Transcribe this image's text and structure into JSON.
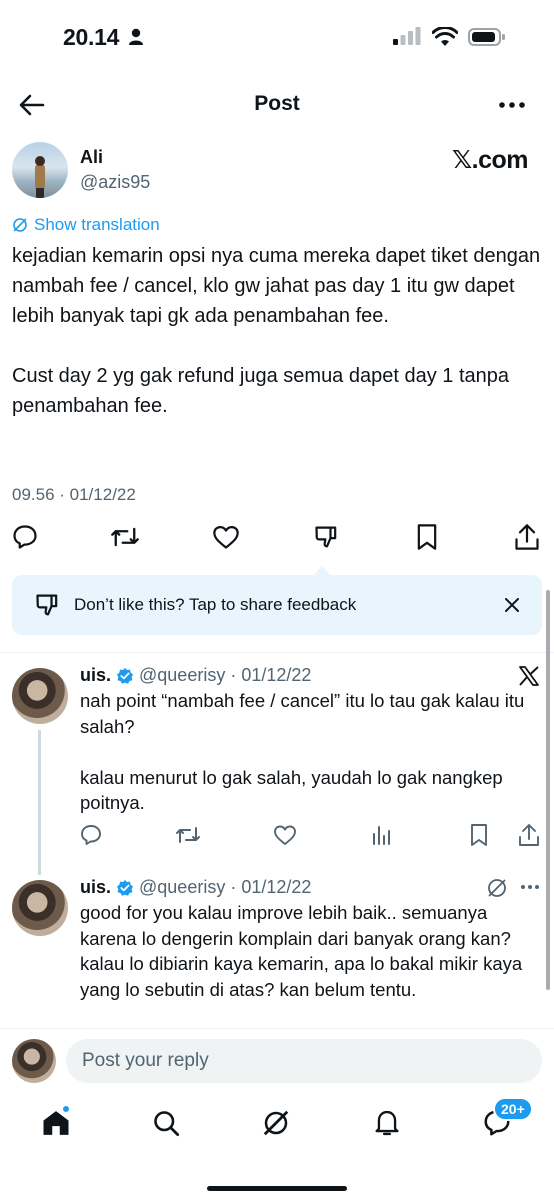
{
  "status": {
    "time": "20.14"
  },
  "header": {
    "title": "Post"
  },
  "post": {
    "author_name": "Ali",
    "author_handle": "@azis95",
    "watermark": "𝕏.com",
    "show_translation": "Show translation",
    "body": "kejadian kemarin opsi nya cuma mereka dapet tiket dengan nambah fee / cancel, klo gw jahat pas day 1 itu gw dapet lebih banyak tapi gk ada penambahan fee.\n\nCust day 2 yg gak refund juga semua dapet day 1 tanpa penambahan fee.",
    "timestamp": "09.56 · 01/12/22"
  },
  "feedback": {
    "text": "Don’t like this? Tap to share feedback"
  },
  "replies": [
    {
      "name": "uis.",
      "handle": "@queerisy",
      "date": "· 01/12/22",
      "body": "nah point “nambah fee / cancel” itu lo tau gak kalau itu salah?\n\nkalau menurut lo gak salah, yaudah lo gak nangkep poitnya."
    },
    {
      "name": "uis.",
      "handle": "@queerisy",
      "date": "· 01/12/22",
      "body": "good for you kalau improve lebih baik.. semuanya karena lo dengerin komplain dari banyak orang kan? kalau lo dibiarin kaya kemarin, apa lo bakal mikir kaya yang lo sebutin di atas? kan belum tentu."
    }
  ],
  "reply_box": {
    "placeholder": "Post your reply"
  },
  "nav": {
    "messages_badge": "20+"
  },
  "colors": {
    "accent": "#1d9bf0",
    "text": "#0f1419",
    "muted": "#536471",
    "banner": "#e8f5fd"
  }
}
